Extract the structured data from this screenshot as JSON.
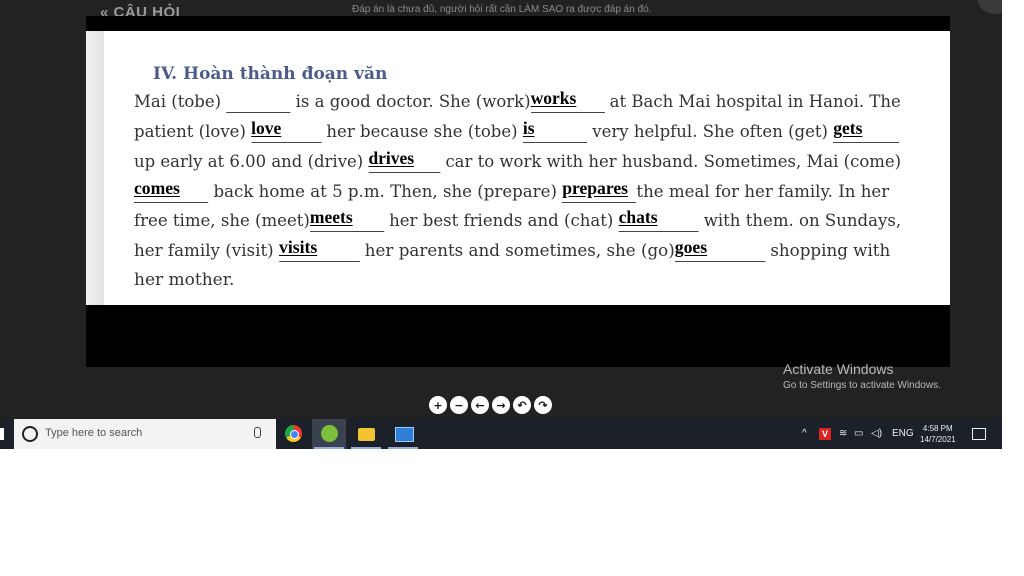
{
  "header": {
    "title": "« CÂU HỎI",
    "note": "Đáp án là chưa đủ, người hỏi rất cần LÀM SAO ra được đáp án đó."
  },
  "document": {
    "title": "IV. Hoàn thành đoạn văn",
    "lines": [
      [
        "Mai (tobe) ",
        "",
        " is a good doctor. She (work)",
        "works",
        " at Bach Mai hospital in Hanoi. The"
      ],
      [
        "patient (love) ",
        "love",
        " her because she (tobe) ",
        "is",
        " very helpful. She often (get) ",
        "gets",
        ""
      ],
      [
        "up early at 6.00 and (drive) ",
        "drives",
        " car to work with her husband. Sometimes, Mai (come)"
      ],
      [
        "",
        "comes",
        " back home at 5 p.m. Then, she (prepare) ",
        "prepares",
        "the meal for her family. In her"
      ],
      [
        "free time, she (meet)",
        "meets",
        " her best friends and (chat) ",
        "chats",
        " with them. on Sundays,"
      ],
      [
        "her family (visit) ",
        "visits",
        " her parents and sometimes, she (go)",
        "goes",
        " shopping with"
      ],
      [
        "her mother."
      ]
    ]
  },
  "watermark": {
    "title": "Activate Windows",
    "subtitle": "Go to Settings to activate Windows."
  },
  "controls": [
    {
      "name": "zoom-in-button",
      "icon": "plus-icon",
      "glyph": "+"
    },
    {
      "name": "zoom-out-button",
      "icon": "minus-icon",
      "glyph": "−"
    },
    {
      "name": "previous-button",
      "icon": "arrow-left-icon",
      "glyph": "←"
    },
    {
      "name": "next-button",
      "icon": "arrow-right-icon",
      "glyph": "→"
    },
    {
      "name": "rotate-left-button",
      "icon": "rotate-left-icon",
      "glyph": "↶"
    },
    {
      "name": "rotate-right-button",
      "icon": "rotate-right-icon",
      "glyph": "↷"
    }
  ],
  "taskbar": {
    "search_placeholder": "Type here to search",
    "language": "ENG",
    "time": "4:58 PM",
    "date": "14/7/2021"
  },
  "colors": {
    "title": "#4c5a8c",
    "body_text": "#333333",
    "answer": "#000000",
    "taskbar": "#1c2028"
  }
}
